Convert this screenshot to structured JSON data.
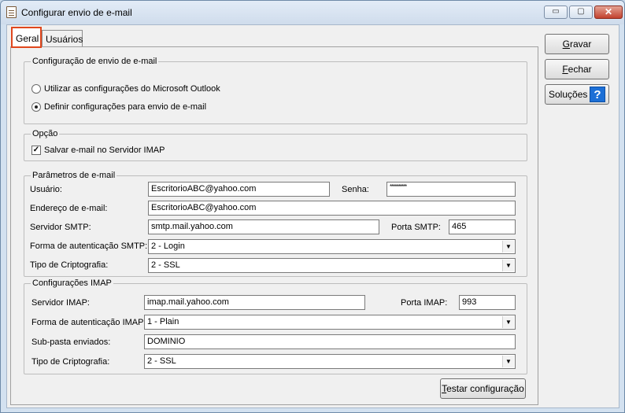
{
  "window": {
    "title": "Configurar envio de e-mail",
    "controls": {
      "minimize": "▭",
      "maximize": "▢",
      "close": "✕"
    }
  },
  "tabs": [
    {
      "label": "Geral",
      "active": true
    },
    {
      "label": "Usuários",
      "active": false
    }
  ],
  "envio": {
    "legend": "Configuração de envio de e-mail",
    "options": [
      {
        "label": "Utilizar as configurações do Microsoft Outlook",
        "selected": false
      },
      {
        "label": "Definir configurações para envio de e-mail",
        "selected": true
      }
    ]
  },
  "opcao": {
    "legend": "Opção",
    "checkbox_label": "Salvar e-mail no Servidor IMAP",
    "checked": true,
    "check_glyph": "✓"
  },
  "parametros": {
    "legend": "Parâmetros de e-mail",
    "usuario_label": "Usuário:",
    "usuario_value": "EscritorioABC@yahoo.com",
    "senha_label": "Senha:",
    "senha_value": "**********",
    "endereco_label": "Endereço de e-mail:",
    "endereco_value": "EscritorioABC@yahoo.com",
    "smtp_label": "Servidor SMTP:",
    "smtp_value": "smtp.mail.yahoo.com",
    "porta_smtp_label": "Porta SMTP:",
    "porta_smtp_value": "465",
    "auth_label": "Forma de autenticação SMTP:",
    "auth_value": "2 - Login",
    "cripto_label": "Tipo de Criptografia:",
    "cripto_value": "2 - SSL"
  },
  "imap": {
    "legend": "Configurações IMAP",
    "servidor_label": "Servidor IMAP:",
    "servidor_value": "imap.mail.yahoo.com",
    "porta_label": "Porta IMAP:",
    "porta_value": "993",
    "auth_label": "Forma de autenticação IMAP:",
    "auth_value": "1 - Plain",
    "subpasta_label": "Sub-pasta enviados:",
    "subpasta_value": "DOMINIO",
    "cripto_label": "Tipo de Criptografia:",
    "cripto_value": "2 - SSL"
  },
  "buttons": {
    "testar_first": "T",
    "testar_rest": "estar configuração",
    "gravar_first": "G",
    "gravar_rest": "ravar",
    "fechar_first": "F",
    "fechar_rest": "echar",
    "solucoes": "Soluções",
    "help_glyph": "?"
  },
  "combo_arrow": "▼"
}
